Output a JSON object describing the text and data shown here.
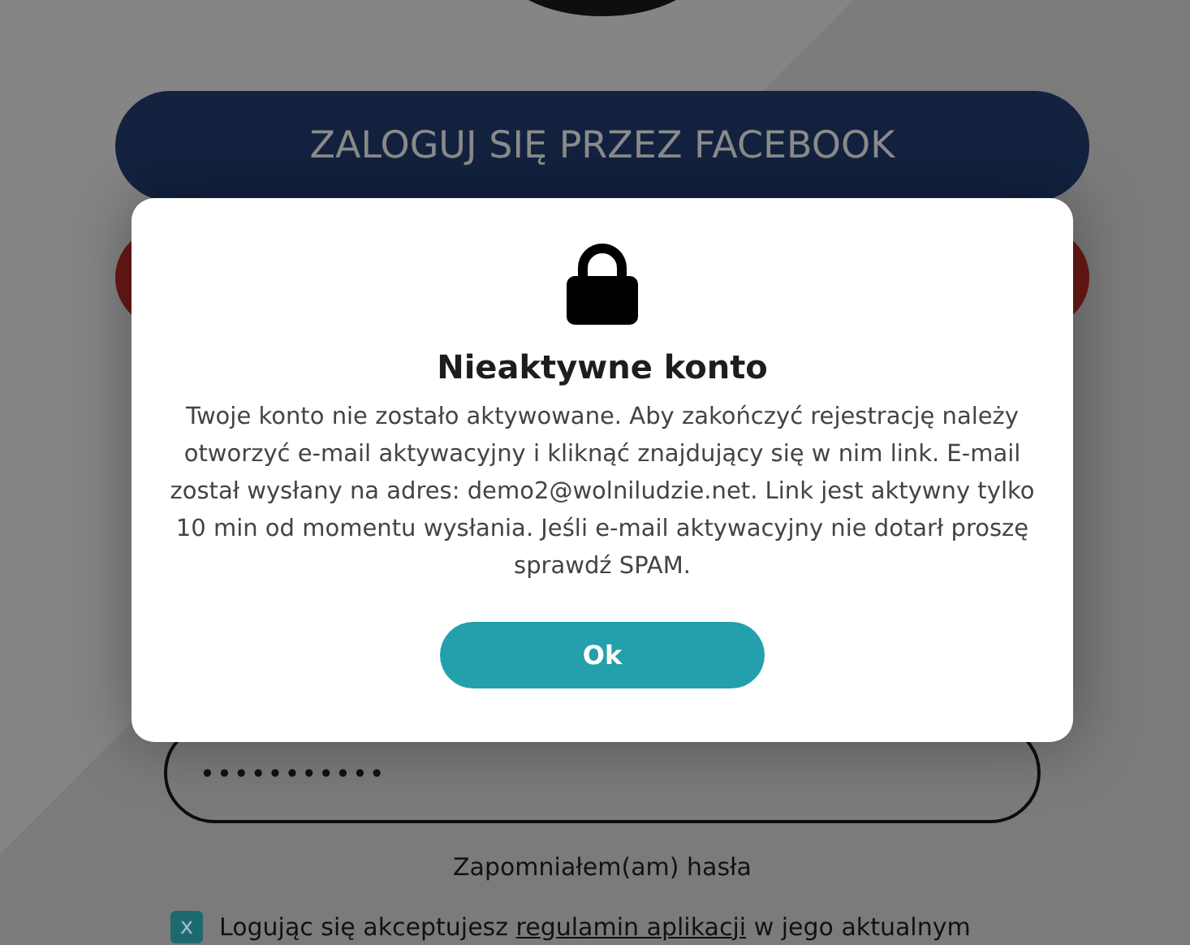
{
  "page": {
    "facebook_button": "ZALOGUJ SIĘ PRZEZ FACEBOOK",
    "password": {
      "value": "•••••••••••"
    },
    "forgot_link": "Zapomniałem(am) hasła",
    "terms": {
      "checked": true,
      "check_glyph": "x",
      "text_before": "Logując się akceptujesz ",
      "link": "regulamin aplikacji",
      "text_after": " w jego aktualnym"
    }
  },
  "dialog": {
    "title": "Nieaktywne konto",
    "message": "Twoje konto nie zostało aktywowane. Aby zakończyć rejestrację należy otworzyć e-mail aktywacyjny i kliknąć znajdujący się w nim link. E-mail został wysłany na adres: demo2@wolniludzie.net. Link jest aktywny tylko 10 min od momentu wysłania. Jeśli e-mail aktywacyjny nie dotarł proszę sprawdź SPAM.",
    "button": "Ok"
  }
}
